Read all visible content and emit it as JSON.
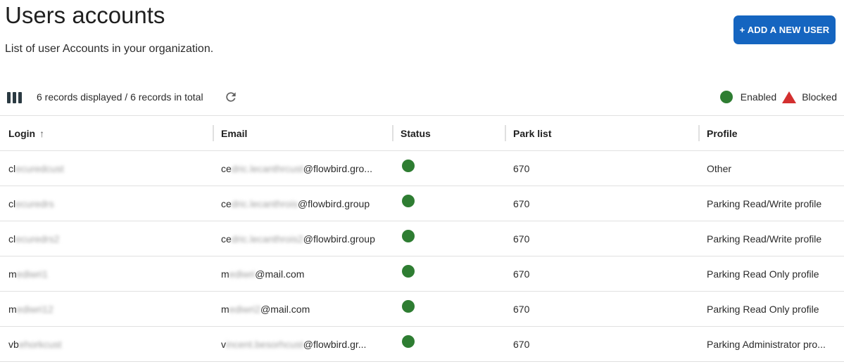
{
  "page": {
    "title": "Users accounts",
    "subtitle": "List of user Accounts in your organization."
  },
  "actions": {
    "add_user_label": "+ ADD A NEW USER"
  },
  "toolbar": {
    "records_text": "6 records displayed / 6 records in total",
    "icons": [
      "view-columns-icon",
      "refresh-icon"
    ]
  },
  "legend": {
    "enabled_label": "Enabled",
    "blocked_label": "Blocked",
    "enabled_color": "#2e7d32",
    "blocked_color": "#d32f2f"
  },
  "table": {
    "columns": [
      "Login",
      "Email",
      "Status",
      "Park list",
      "Profile"
    ],
    "sort": {
      "column": "Login",
      "direction": "asc"
    },
    "rows": [
      {
        "login_prefix": "cl",
        "login_hidden": "ecuredcust",
        "email_prefix": "ce",
        "email_hidden": "dric.lecanthrcust",
        "email_domain": "@flowbird.gro...",
        "status": "enabled",
        "park_list": "670",
        "profile": "Other"
      },
      {
        "login_prefix": "cl",
        "login_hidden": "ecuredrs",
        "email_prefix": "ce",
        "email_hidden": "dric.lecanthrois",
        "email_domain": "@flowbird.group",
        "status": "enabled",
        "park_list": "670",
        "profile": "Parking Read/Write profile"
      },
      {
        "login_prefix": "cl",
        "login_hidden": "ecuredrs2",
        "email_prefix": "ce",
        "email_hidden": "dric.lecanthrois2",
        "email_domain": "@flowbird.group",
        "status": "enabled",
        "park_list": "670",
        "profile": "Parking Read/Write profile"
      },
      {
        "login_prefix": "m",
        "login_hidden": "ediwri1",
        "email_prefix": "m",
        "email_hidden": "ediwri",
        "email_domain": "@mail.com",
        "status": "enabled",
        "park_list": "670",
        "profile": "Parking Read Only profile"
      },
      {
        "login_prefix": "m",
        "login_hidden": "ediwri12",
        "email_prefix": "m",
        "email_hidden": "ediwri2",
        "email_domain": "@mail.com",
        "status": "enabled",
        "park_list": "670",
        "profile": "Parking Read Only profile"
      },
      {
        "login_prefix": "vb",
        "login_hidden": "ehorkcust",
        "email_prefix": "v",
        "email_hidden": "incent.besorhcust",
        "email_domain": "@flowbird.gr...",
        "status": "enabled",
        "park_list": "670",
        "profile": "Parking Administrator pro..."
      }
    ]
  }
}
